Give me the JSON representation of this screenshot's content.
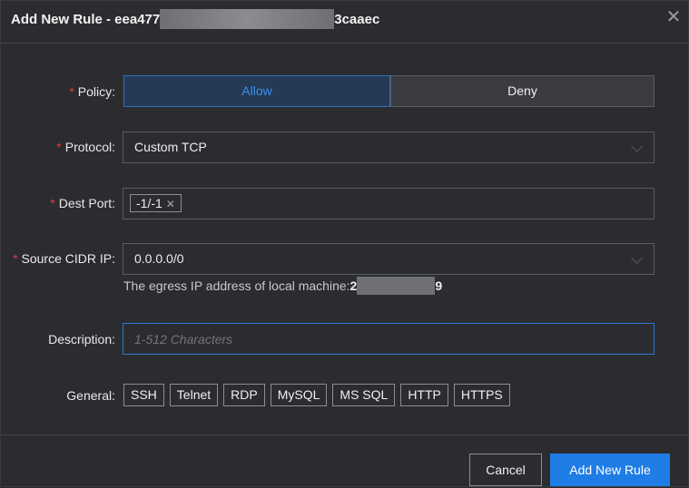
{
  "dialog": {
    "title_prefix": "Add New Rule - eea477",
    "title_suffix": "3caaec",
    "close_icon": "close-icon"
  },
  "form": {
    "policy": {
      "label": "Policy:",
      "options": [
        "Allow",
        "Deny"
      ],
      "selected": "Allow"
    },
    "protocol": {
      "label": "Protocol:",
      "value": "Custom TCP"
    },
    "dest_port": {
      "label": "Dest Port:",
      "tag": "-1/-1"
    },
    "source_cidr": {
      "label": "Source CIDR IP:",
      "value": "0.0.0.0/0"
    },
    "egress_hint": {
      "text": "The egress IP address of local machine:",
      "ip_prefix": "2",
      "ip_suffix": "9"
    },
    "description": {
      "label": "Description:",
      "placeholder": "1-512 Characters",
      "value": ""
    },
    "general": {
      "label": "General:",
      "buttons": [
        "SSH",
        "Telnet",
        "RDP",
        "MySQL",
        "MS SQL",
        "HTTP",
        "HTTPS"
      ]
    }
  },
  "footer": {
    "cancel_label": "Cancel",
    "add_label": "Add New Rule"
  },
  "colors": {
    "accent": "#1f7de6",
    "required": "#e0393e",
    "background": "#2b2c30"
  }
}
